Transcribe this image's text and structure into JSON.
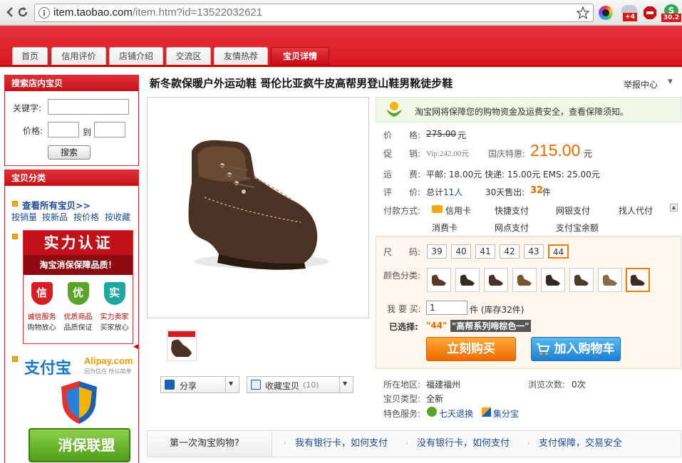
{
  "browser": {
    "url_host": "item.taobao.com",
    "url_path": "/item.htm?id=13522032621",
    "badge_plus4": "+4",
    "badge_302": "30.2"
  },
  "tabs": [
    "首页",
    "信用评价",
    "店铺介绍",
    "交流区",
    "友情热荐",
    "宝贝详情"
  ],
  "sidebar": {
    "search_title": "搜索店内宝贝",
    "keyword_label": "关键字:",
    "price_label": "价格:",
    "to_label": "到",
    "search_button": "搜索",
    "category_title": "宝贝分类",
    "view_all": "查看所有宝贝>>",
    "sort_links": [
      "按销量",
      "按新品",
      "按价格",
      "按收藏"
    ],
    "cert_title": "实力认证",
    "cert_subtitle": "淘宝消保保障品质！",
    "cert_items": [
      {
        "badge": "信",
        "name": "诚信服务",
        "desc": "购物放心"
      },
      {
        "badge": "优",
        "name": "优质商品",
        "desc": "品质保证"
      },
      {
        "badge": "实",
        "name": "实力卖家",
        "desc": "买家放心"
      }
    ],
    "alipay_cn": "支付宝",
    "alipay_en": "Alipay.com",
    "alipay_slogan": "因为信任 所以简单",
    "xiaobao": "消保联盟"
  },
  "product": {
    "title": "新冬款保暖户外运动鞋 哥伦比亚疯牛皮高帮男登山鞋男靴徒步鞋",
    "report": "举报中心",
    "guarantee_text": "淘宝网将保障您的购物资金及运费安全，",
    "guarantee_link": "查看保障须知",
    "guarantee_end": "。",
    "price_label": "价　　格:",
    "original_price": "275.00",
    "yuan": "元",
    "promo_label": "促　　销:",
    "vip_price": "Vip:242.00元",
    "holiday_label": "国庆特惠:",
    "holiday_price": "215.00",
    "shipping_label": "运　　费:",
    "shipping_value": "平邮: 18.00元 快递: 15.00元 EMS: 25.00元",
    "review_label": "评　　价:",
    "review_total": "总计",
    "review_count": "11人",
    "sold_label": "30天售出:",
    "sold_count": "32",
    "sold_unit": "件",
    "payment_label": "付款方式:",
    "payments": [
      "信用卡",
      "快捷支付",
      "网银支付",
      "找人代付",
      "消费卡",
      "网点支付",
      "支付宝余额"
    ],
    "size_label": "尺　　码:",
    "sizes": [
      "39",
      "40",
      "41",
      "42",
      "43",
      "44"
    ],
    "color_label": "颜色分类:",
    "qty_label": "我 要 买:",
    "qty_value": "1",
    "stock_text": "件 (库存32件)",
    "selected_label": "已选择:",
    "selected_size": "\"44\"",
    "selected_color": "\"高帮系列啼棕色一\"",
    "buy_button": "立刻购买",
    "cart_button": "加入购物车",
    "share": "分享",
    "favorite": "收藏宝贝",
    "favorite_count": "(10)",
    "location_label": "所在地区:",
    "location": "福建福州",
    "views_label": "浏览次数:",
    "views": "0次",
    "type_label": "宝贝类型:",
    "type": "全新",
    "service_label": "特色服务:",
    "return_service": "七天退换",
    "points_service": "集分宝"
  },
  "bottom": {
    "first_time": "第一次淘宝购物?",
    "links": [
      "我有银行卡，如何支付",
      "没有银行卡，如何支付",
      "支付保障，交易安全"
    ]
  },
  "colors": {
    "red": "#d71922",
    "orange": "#f06a00",
    "link": "#1d4aa0"
  }
}
